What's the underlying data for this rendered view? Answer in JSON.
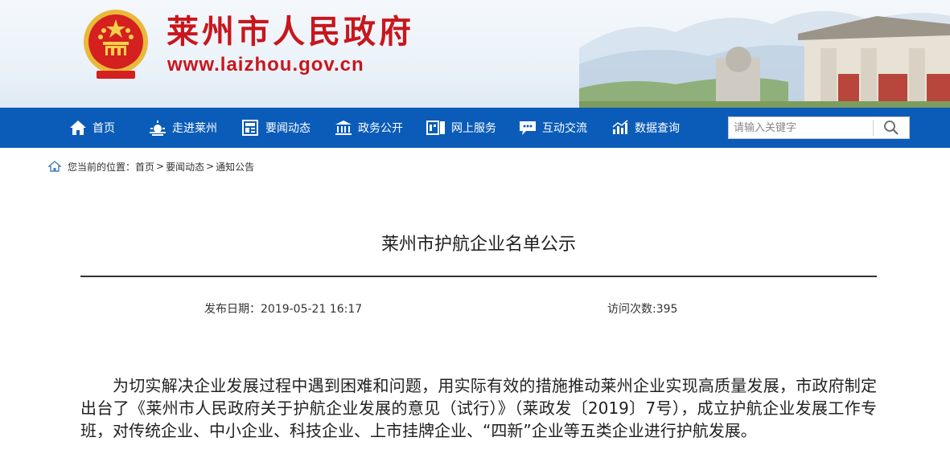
{
  "header": {
    "site_title": "莱州市人民政府",
    "site_url": "www.laizhou.gov.cn",
    "emblem_icon": "national-emblem-icon",
    "brand_red": "#c8161d"
  },
  "nav": {
    "bar_color": "#0b5cb8",
    "items": [
      {
        "label": "首页",
        "icon": "home-icon"
      },
      {
        "label": "走进莱州",
        "icon": "sunrise-icon"
      },
      {
        "label": "要闻动态",
        "icon": "news-icon"
      },
      {
        "label": "政务公开",
        "icon": "government-building-icon"
      },
      {
        "label": "网上服务",
        "icon": "online-service-icon"
      },
      {
        "label": "互动交流",
        "icon": "chat-icon"
      },
      {
        "label": "数据查询",
        "icon": "bar-chart-icon"
      }
    ],
    "search": {
      "placeholder": "请输入关键字",
      "icon": "search-icon"
    }
  },
  "breadcrumb": {
    "prefix": "您当前的位置：",
    "items": [
      "首页",
      "要闻动态",
      "通知公告"
    ],
    "separator": ">"
  },
  "article": {
    "title": "莱州市护航企业名单公示",
    "publish_date": "发布日期：2019-05-21 16:17",
    "visits": "访问次数:395",
    "body": "为切实解决企业发展过程中遇到困难和问题，用实际有效的措施推动莱州企业实现高质量发展，市政府制定出台了《莱州市人民政府关于护航企业发展的意见（试行）》（莱政发〔2019〕7号），成立护航企业发展工作专班，对传统企业、中小企业、科技企业、上市挂牌企业、“四新”企业等五类企业进行护航发展。"
  }
}
